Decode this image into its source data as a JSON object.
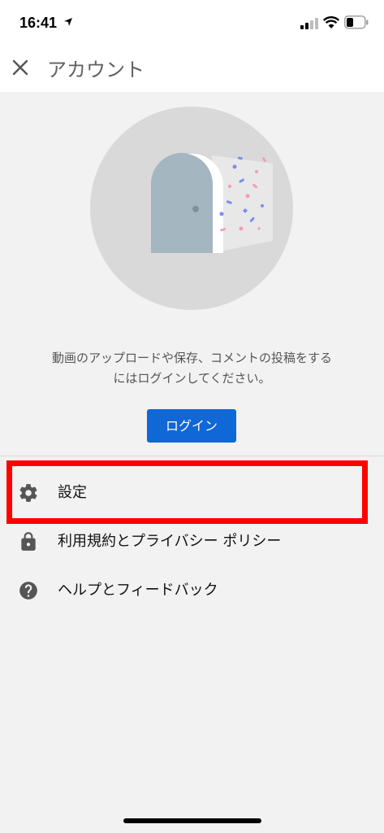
{
  "status_bar": {
    "time": "16:41",
    "icons": [
      "location-arrow-icon",
      "cellular-signal-icon",
      "wifi-icon",
      "battery-icon"
    ]
  },
  "header": {
    "close_icon": "close-icon",
    "title": "アカウント"
  },
  "illustration": {
    "icon": "door-confetti-illustration"
  },
  "prompt": {
    "line1": "動画のアップロードや保存、コメントの投稿をする",
    "line2": "にはログインしてください。"
  },
  "login_button": {
    "label": "ログイン",
    "color": "#1067d6"
  },
  "menu": {
    "items": [
      {
        "icon": "gear-icon",
        "label": "設定"
      },
      {
        "icon": "lock-icon",
        "label": "利用規約とプライバシー ポリシー"
      },
      {
        "icon": "help-icon",
        "label": "ヘルプとフィードバック"
      }
    ]
  },
  "highlight_color": "#ff0000"
}
